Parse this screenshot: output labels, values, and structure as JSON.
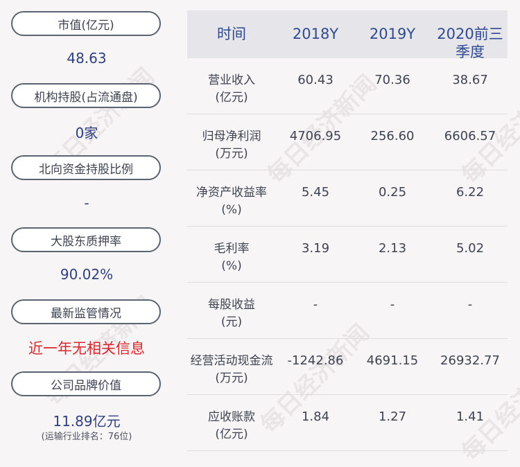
{
  "left_panel": [
    {
      "label": "市值(亿元)",
      "value": "48.63"
    },
    {
      "label": "机构持股(占流通盘)",
      "value": "0家"
    },
    {
      "label": "北向资金持股比例",
      "value": "-"
    },
    {
      "label": "大股东质押率",
      "value": "90.02%"
    },
    {
      "label": "最新监管情况",
      "value": "近一年无相关信息"
    },
    {
      "label": "公司品牌价值",
      "value": "11.89亿元",
      "note": "(运输行业排名：76位)"
    }
  ],
  "table": {
    "headers": [
      "时间",
      "2018Y",
      "2019Y",
      "2020前三季度"
    ],
    "rows": [
      {
        "label": "营业收入(亿元)",
        "line1": "营业收入",
        "line2": "(亿元)",
        "values": [
          "60.43",
          "70.36",
          "38.67"
        ]
      },
      {
        "label": "归母净利润(万元)",
        "line1": "归母净利润",
        "line2": "(万元)",
        "values": [
          "4706.95",
          "256.60",
          "6606.57"
        ]
      },
      {
        "label": "净资产收益率(%)",
        "line1": "净资产收益率",
        "line2": "(%)",
        "values": [
          "5.45",
          "0.25",
          "6.22"
        ]
      },
      {
        "label": "毛利率(%)",
        "line1": "毛利率",
        "line2": "(%)",
        "values": [
          "3.19",
          "2.13",
          "5.02"
        ]
      },
      {
        "label": "每股收益(元)",
        "line1": "每股收益",
        "line2": "(元)",
        "values": [
          "-",
          "-",
          "-"
        ]
      },
      {
        "label": "经营活动现金流(万元)",
        "line1": "经营活动现金流",
        "line2": "(万元)",
        "values": [
          "-1242.86",
          "4691.15",
          "26932.77"
        ]
      },
      {
        "label": "应收账款(亿元)",
        "line1": "应收账款",
        "line2": "(亿元)",
        "values": [
          "1.84",
          "1.27",
          "1.41"
        ]
      }
    ]
  },
  "watermark": "每日经济新闻",
  "colors": {
    "value_blue": "#2f3f7f",
    "alert_red": "#d9262b",
    "header_blue": "#2f4a8f",
    "header_bg": "#e6e5ea"
  }
}
